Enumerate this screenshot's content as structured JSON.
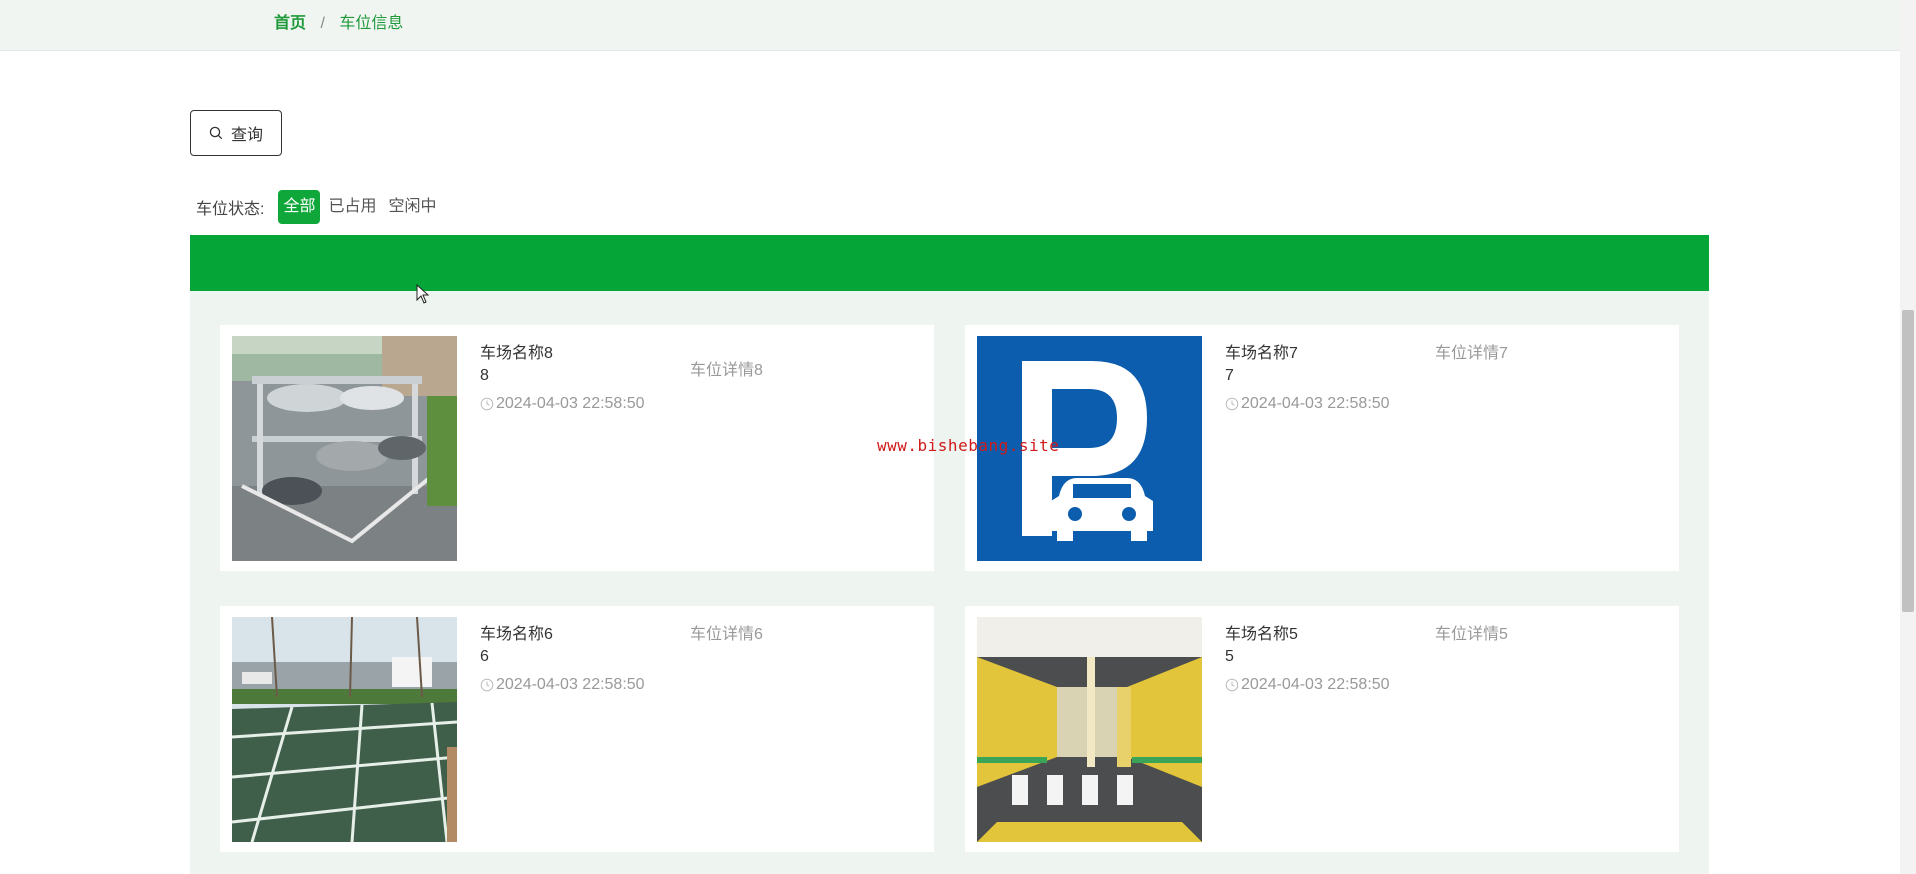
{
  "breadcrumb": {
    "home": "首页",
    "separator": "/",
    "current": "车位信息"
  },
  "search": {
    "label": "查询",
    "icon": "search-icon"
  },
  "status_filter": {
    "label": "车位状态:",
    "options": [
      "全部",
      "已占用",
      "空闲中"
    ],
    "active": "全部"
  },
  "cards": [
    {
      "name": "车场名称8",
      "number": "8",
      "time": "2024-04-03 22:58:50",
      "detail": "车位详情8"
    },
    {
      "name": "车场名称7",
      "number": "7",
      "time": "2024-04-03 22:58:50",
      "detail": "车位详情7"
    },
    {
      "name": "车场名称6",
      "number": "6",
      "time": "2024-04-03 22:58:50",
      "detail": "车位详情6"
    },
    {
      "name": "车场名称5",
      "number": "5",
      "time": "2024-04-03 22:58:50",
      "detail": "车位详情5"
    }
  ],
  "watermark": "www.bishebang.site",
  "colors": {
    "accent": "#05a637",
    "breadcrumb": "#1f9a3b",
    "watermark": "#d11b1b"
  }
}
